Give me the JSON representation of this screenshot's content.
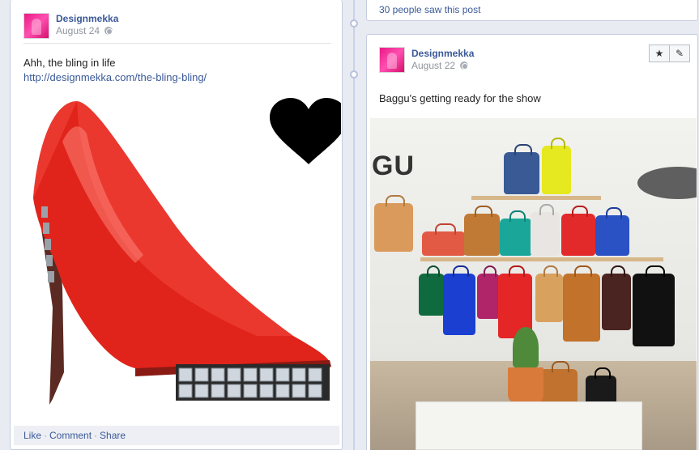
{
  "left_post": {
    "author": "Designmekka",
    "date": "August 24",
    "text": "Ahh, the bling in life",
    "link": "http://designmekka.com/the-bling-bling/",
    "actions": [
      "Like",
      "Comment",
      "Share"
    ]
  },
  "right_top": {
    "seen_text": "30 people saw this post"
  },
  "right_post": {
    "author": "Designmekka",
    "date": "August 22",
    "text": "Baggu's getting ready for the show",
    "store_sign": "GU"
  },
  "colors": {
    "link": "#3b5998",
    "shoe": "#e0241b",
    "heart": "#000000"
  },
  "icons": [
    "globe-icon",
    "star-icon",
    "pencil-icon",
    "heart-icon"
  ]
}
